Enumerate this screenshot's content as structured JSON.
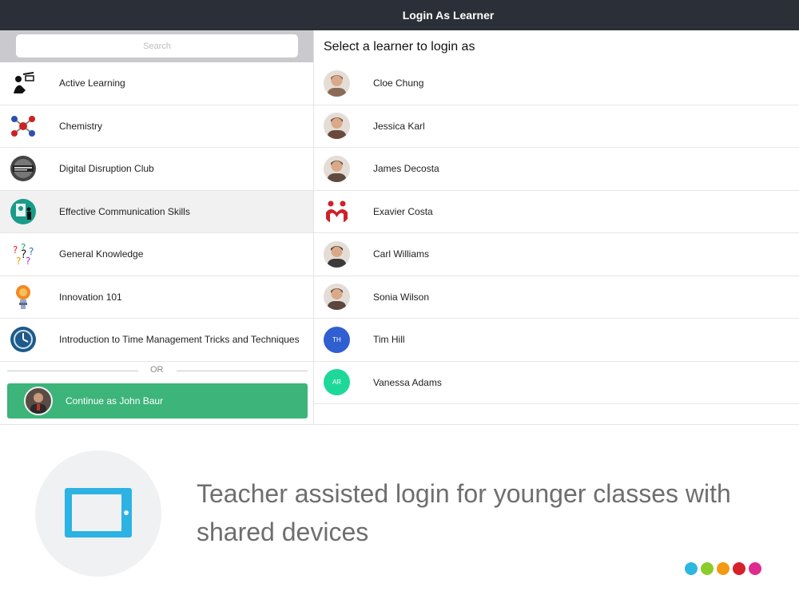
{
  "header": {
    "title": "Login As Learner"
  },
  "search": {
    "placeholder": "Search"
  },
  "classes": [
    {
      "label": "Active Learning",
      "icon": "active-learning-icon",
      "selected": false
    },
    {
      "label": "Chemistry",
      "icon": "molecule-icon",
      "selected": false
    },
    {
      "label": "Digital Disruption Club",
      "icon": "digital-disruption-icon",
      "selected": false
    },
    {
      "label": "Effective Communication Skills",
      "icon": "presentation-icon",
      "selected": true
    },
    {
      "label": "General Knowledge",
      "icon": "question-marks-icon",
      "selected": false
    },
    {
      "label": "Innovation 101",
      "icon": "medal-icon",
      "selected": false
    },
    {
      "label": "Introduction to Time Management Tricks and Techniques",
      "icon": "clock-globe-icon",
      "selected": false
    }
  ],
  "divider": {
    "or_label": "OR"
  },
  "continue": {
    "label": "Continue as John Baur"
  },
  "learners_panel": {
    "title": "Select a learner to login as"
  },
  "learners": [
    {
      "name": "Cloe Chung",
      "initials": "",
      "color": "#8a6b58"
    },
    {
      "name": "Jessica Karl",
      "initials": "",
      "color": "#6b4a3e"
    },
    {
      "name": "James Decosta",
      "initials": "",
      "color": "#5e4a3f"
    },
    {
      "name": "Exavier Costa",
      "initials": "",
      "color": "#d0202a"
    },
    {
      "name": "Carl Williams",
      "initials": "",
      "color": "#3a3a3a"
    },
    {
      "name": "Sonia Wilson",
      "initials": "",
      "color": "#5b4640"
    },
    {
      "name": "Tim Hill",
      "initials": "TH",
      "color": "#2f5fd0"
    },
    {
      "name": "Vanessa Adams",
      "initials": "AR",
      "color": "#1ed89a"
    }
  ],
  "promo": {
    "tagline": "Teacher assisted login for younger classes with shared devices"
  },
  "brand_dots": [
    "#2cb7e2",
    "#8bcc2a",
    "#f39a12",
    "#d6212b",
    "#de2b8e"
  ],
  "colors": {
    "topbar": "#2b2f38",
    "continue_button": "#3cb47a",
    "tablet": "#2cb3e3"
  }
}
